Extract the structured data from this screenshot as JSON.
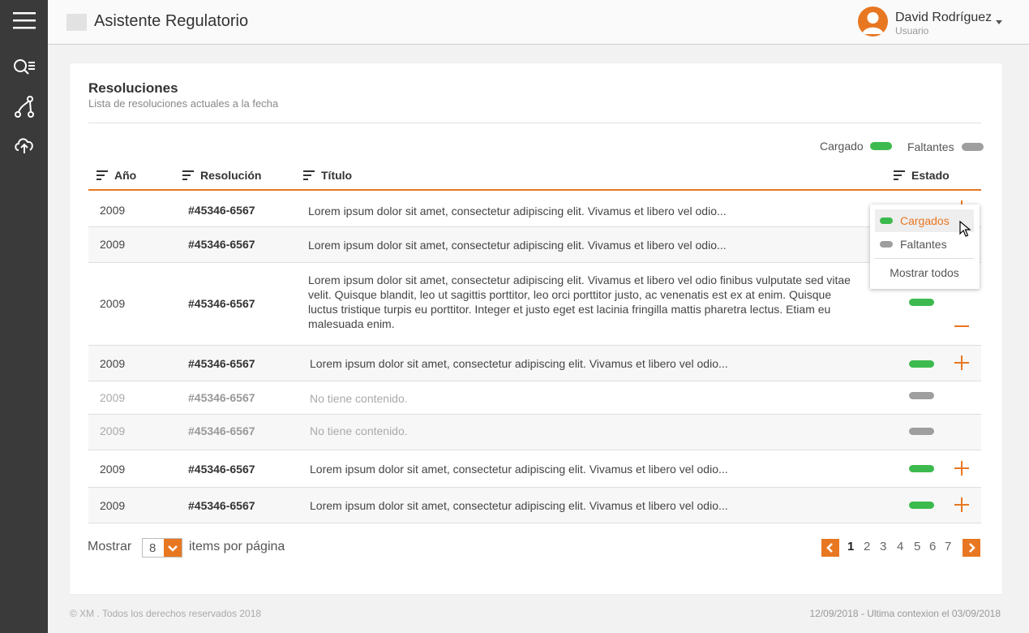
{
  "header": {
    "app_title": "Asistente Regulatorio",
    "user_name": "David Rodríguez",
    "user_role": "Usuario"
  },
  "sidebar": {
    "icons": [
      "menu-icon",
      "search-list-icon",
      "flow-icon",
      "cloud-upload-icon"
    ]
  },
  "card": {
    "title": "Resoluciones",
    "subtitle": "Lista de resoluciones actuales a la fecha"
  },
  "legend": {
    "loaded": "Cargado",
    "missing": "Faltantes"
  },
  "table": {
    "headers": {
      "year": "Año",
      "resolution": "Resolución",
      "title": "Título",
      "status": "Estado"
    },
    "rows": [
      {
        "year": "2009",
        "resolution": "#45346-6567",
        "title": "Lorem ipsum dolor sit amet, consectetur adipiscing elit. Vivamus et libero vel odio...",
        "status": "cargado",
        "action": "plus"
      },
      {
        "year": "2009",
        "resolution": "#45346-6567",
        "title": "Lorem ipsum dolor sit amet, consectetur adipiscing elit. Vivamus et libero vel odio...",
        "status": "cargado",
        "action": "plus"
      },
      {
        "year": "2009",
        "resolution": "#45346-6567",
        "title": "Lorem ipsum dolor sit amet, consectetur adipiscing elit. Vivamus et libero vel odio finibus vulputate sed vitae velit. Quisque blandit, leo ut sagittis porttitor, leo orci porttitor justo, ac venenatis est ex at enim. Quisque luctus tristique turpis eu porttitor. Integer et justo eget est lacinia fringilla mattis pharetra lectus. Etiam eu malesuada enim.",
        "status": "cargado",
        "action": "minus"
      },
      {
        "year": "2009",
        "resolution": "#45346-6567",
        "title": "Lorem ipsum dolor sit amet, consectetur adipiscing elit. Vivamus et libero vel odio...",
        "status": "cargado",
        "action": "plus"
      },
      {
        "year": "2009",
        "resolution": "#45346-6567",
        "title": "No tiene contenido.",
        "status": "faltante",
        "action": "none"
      },
      {
        "year": "2009",
        "resolution": "#45346-6567",
        "title": "No tiene contenido.",
        "status": "faltante",
        "action": "none"
      },
      {
        "year": "2009",
        "resolution": "#45346-6567",
        "title": "Lorem ipsum dolor sit amet, consectetur adipiscing elit. Vivamus et libero vel odio...",
        "status": "cargado",
        "action": "plus"
      },
      {
        "year": "2009",
        "resolution": "#45346-6567",
        "title": "Lorem ipsum dolor sit amet, consectetur adipiscing elit. Vivamus et libero vel odio...",
        "status": "cargado",
        "action": "plus"
      }
    ]
  },
  "filter_dropdown": {
    "options": [
      "Cargados",
      "Faltantes"
    ],
    "selected": "Cargados",
    "show_all": "Mostrar todos"
  },
  "pagination": {
    "show_label": "Mostrar",
    "per_page": "8",
    "items_label": "items por página",
    "pages": [
      "1",
      "2",
      "3",
      "4",
      "5",
      "6",
      "7"
    ],
    "current_page": "1"
  },
  "footer": {
    "copyright": "© XM . Todos los derechos reservados 2018",
    "last_connection": "12/09/2018 - Ultima contexion el 03/09/2018"
  },
  "colors": {
    "accent": "#e87722",
    "loaded": "#3dba4e",
    "missing": "#9e9e9e",
    "sidebar": "#3a3a3a"
  }
}
